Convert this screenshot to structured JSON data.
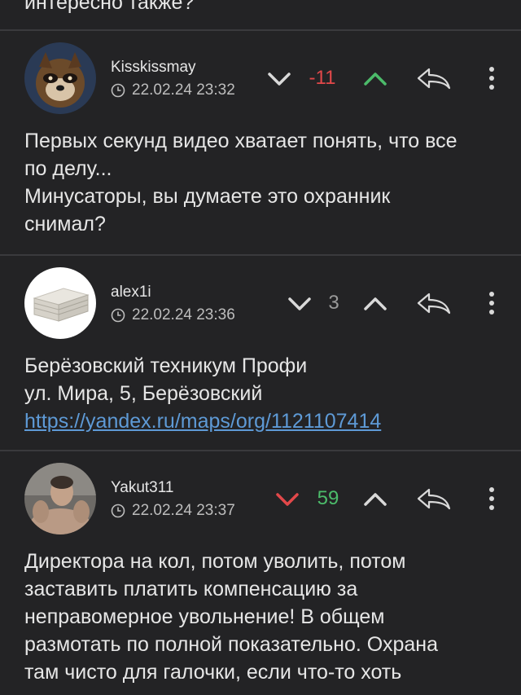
{
  "previous": {
    "text": "интересно также?"
  },
  "comments": [
    {
      "username": "Kisskissmay",
      "time": "22.02.24 23:32",
      "score": "-11",
      "score_color": "#e2484a",
      "vote_up_color": "#4cbb6a",
      "vote_down_color": "#d9d9d9",
      "lines": [
        "Первых секунд видео хватает понять, что все",
        "по делу...",
        "Минусаторы, вы думаете это охранник",
        "снимал?"
      ]
    },
    {
      "username": "alex1i",
      "time": "22.02.24 23:36",
      "score": "3",
      "score_color": "#9a9a9a",
      "vote_up_color": "#d9d9d9",
      "vote_down_color": "#d9d9d9",
      "lines": [
        "Берёзовский техникум Профи",
        "ул. Мира, 5, Берёзовский"
      ],
      "link": "https://yandex.ru/maps/org/1121107414"
    },
    {
      "username": "Yakut311",
      "time": "22.02.24 23:37",
      "score": "59",
      "score_color": "#4cbb6a",
      "vote_up_color": "#d9d9d9",
      "vote_down_color": "#e2484a",
      "lines": [
        "Директора на кол, потом уволить, потом",
        "заставить платить компенсацию за",
        "неправомерное увольнение! В общем",
        "размотать по полной показательно. Охрана",
        "там чисто для галочки, если что-то хоть"
      ]
    }
  ],
  "icons": {
    "clock": "clock-icon",
    "vote_down": "chevron-down-icon",
    "vote_up": "chevron-up-icon",
    "reply": "reply-icon",
    "more": "more-vertical-icon"
  }
}
